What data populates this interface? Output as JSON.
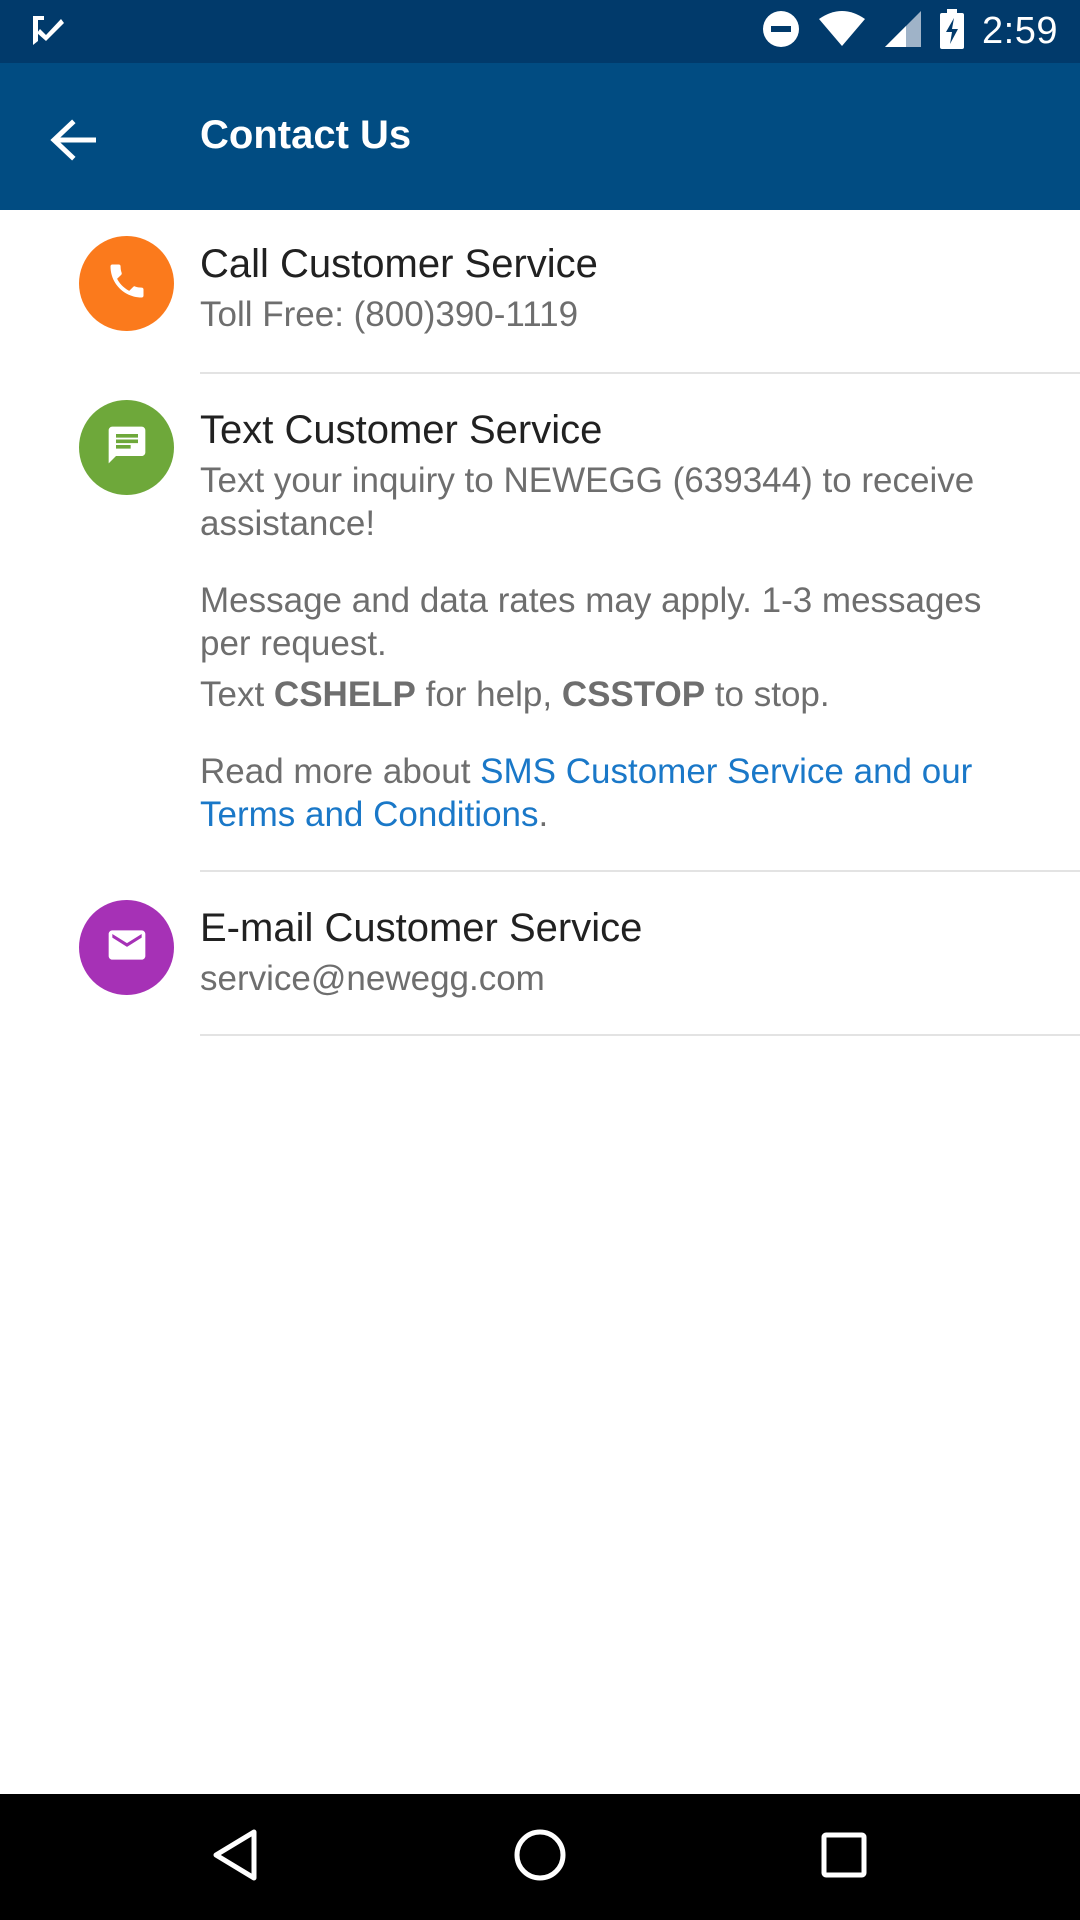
{
  "status_bar": {
    "time": "2:59",
    "icons": [
      "notification-check-icon",
      "do-not-disturb-icon",
      "wifi-icon",
      "signal-icon",
      "battery-charging-icon"
    ]
  },
  "app_bar": {
    "title": "Contact Us",
    "back_icon": "arrow-back-icon"
  },
  "items": {
    "call": {
      "icon": "phone-icon",
      "color": "#FB7A1C",
      "title": "Call Customer Service",
      "subtitle": "Toll Free: (800)390-1119"
    },
    "text": {
      "icon": "message-icon",
      "color": "#6EA83A",
      "title": "Text Customer Service",
      "line1": "Text your inquiry to NEWEGG (639344) to receive assistance!",
      "line2": "Message and data rates may apply. 1-3 messages per request.",
      "line3_a": "Text ",
      "line3_bold1": "CSHELP",
      "line3_b": " for help, ",
      "line3_bold2": "CSSTOP",
      "line3_c": " to stop.",
      "line4_prefix": "Read more about ",
      "line4_link": "SMS Customer Service and our Terms and Conditions",
      "line4_suffix": "."
    },
    "email": {
      "icon": "mail-icon",
      "color": "#A631B6",
      "title": "E-mail Customer Service",
      "subtitle": "service@newegg.com"
    }
  },
  "nav_bar": {
    "back": "nav-back-icon",
    "home": "nav-home-icon",
    "recents": "nav-recents-icon"
  },
  "colors": {
    "status_bar": "#013A6B",
    "app_bar": "#014C82",
    "link": "#1A78C8"
  }
}
